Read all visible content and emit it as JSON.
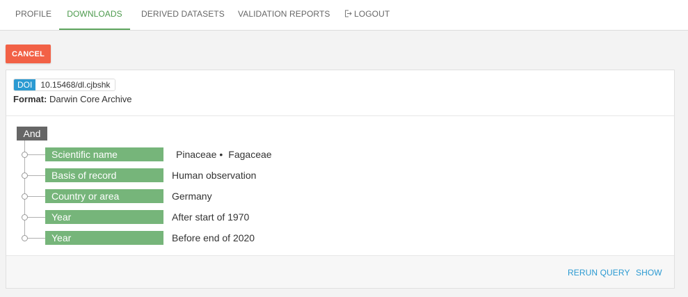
{
  "nav": {
    "tabs": [
      {
        "label": "PROFILE"
      },
      {
        "label": "DOWNLOADS"
      },
      {
        "label": "DERIVED DATASETS"
      },
      {
        "label": "VALIDATION REPORTS"
      },
      {
        "label": "LOGOUT",
        "icon": "logout-icon"
      }
    ],
    "active_tab": "DOWNLOADS"
  },
  "cancel_label": "CANCEL",
  "download": {
    "doi_label": "DOI",
    "doi_value": "10.15468/dl.cjbshk",
    "format_key": "Format:",
    "format_value": "Darwin Core Archive"
  },
  "query": {
    "operator": "And",
    "filters": [
      {
        "label": "Scientific name",
        "values": [
          "Pinaceae",
          "Fagaceae"
        ]
      },
      {
        "label": "Basis of record",
        "value": "Human observation"
      },
      {
        "label": "Country or area",
        "value": "Germany"
      },
      {
        "label": "Year",
        "value": "After start of 1970"
      },
      {
        "label": "Year",
        "value": "Before end of 2020"
      }
    ]
  },
  "actions": {
    "rerun_label": "RERUN QUERY",
    "show_label": "SHOW"
  },
  "colors": {
    "active_tab": "#4c9a4c",
    "cancel_bg": "#f26146",
    "doi_bg": "#2b9ad2",
    "filter_pill": "#76b57a",
    "operator_bg": "#666666",
    "link": "#2b9ad2"
  }
}
